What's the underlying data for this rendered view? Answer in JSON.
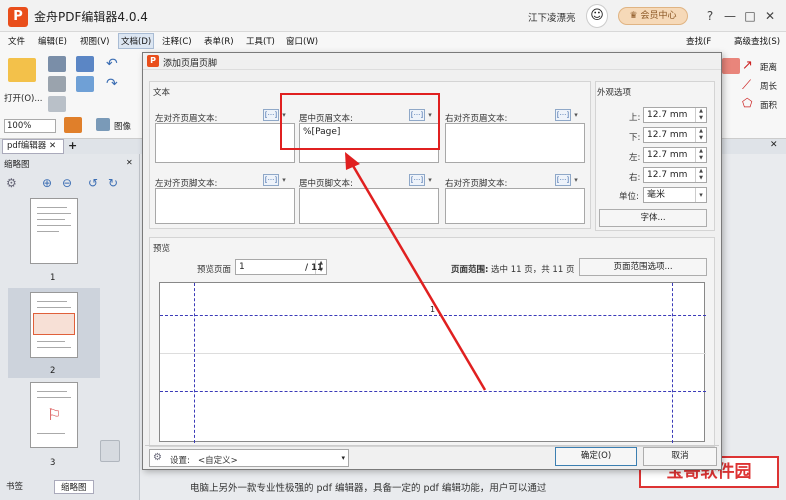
{
  "app": {
    "title": "金舟PDF编辑器4.0.4",
    "user": "江下凌漂亮",
    "vip_button": "会员中心"
  },
  "window_controls": {
    "help": "?",
    "minimize": "—",
    "maximize": "□",
    "close": "✕"
  },
  "menu": [
    "文件",
    "编辑(E)",
    "视图(V)",
    "文档(D)",
    "注释(C)",
    "表单(R)",
    "工具(T)",
    "窗口(W)"
  ],
  "menu_selected": "文档(D)",
  "toolbar_right": {
    "find": "查找(F",
    "advanced_find": "高级查找(S)",
    "distance": "距离",
    "perimeter": "周长",
    "area": "面积"
  },
  "ribbon": {
    "open": "打开(O)...",
    "zoom": "100%",
    "image": "图像"
  },
  "doc_tab": "pdf编辑器",
  "thumbnail_panel": {
    "title": "缩略图",
    "pages": [
      "1",
      "2",
      "3"
    ]
  },
  "bottom_tabs": {
    "bookmarks": "书签",
    "thumbnails": "缩略图"
  },
  "caption": "电脑上另外一款专业性极强的 pdf 编辑器，具备一定的 pdf 编辑功能，用户可以通过",
  "watermark": "宝哥软件园",
  "dialog": {
    "title": "添加页眉页脚",
    "text_group": "文本",
    "left_header": "左对齐页眉文本:",
    "center_header": "居中页眉文本:",
    "right_header": "右对齐页眉文本:",
    "center_header_value": "%[Page]",
    "left_footer": "左对齐页脚文本:",
    "center_footer": "居中页脚文本:",
    "right_footer": "右对齐页脚文本:",
    "insert_symbol": "[···]",
    "appearance_group": "外观选项",
    "top_label": "上:",
    "top_value": "12.7 mm",
    "bottom_label": "下:",
    "bottom_value": "12.7 mm",
    "left_label": "左:",
    "left_value": "12.7 mm",
    "right_label": "右:",
    "right_value": "12.7 mm",
    "unit_label": "单位:",
    "unit_value": "毫米",
    "font_button": "字体...",
    "preview_group": "预览",
    "preview_page_label": "预览页面",
    "preview_page_value": "1",
    "preview_total": "/ 11",
    "page_range_label": "页面范围:",
    "page_range_value": "选中 11 页，共 11 页",
    "page_range_button": "页面范围选项...",
    "preview_number": "1",
    "settings_label": "设置:",
    "settings_value": "<自定义>",
    "ok_button": "确定(O)",
    "cancel_button": "取消"
  },
  "colors": {
    "accent": "#e94e1b",
    "annotation": "#e02020",
    "guide": "#3b3bb8"
  }
}
